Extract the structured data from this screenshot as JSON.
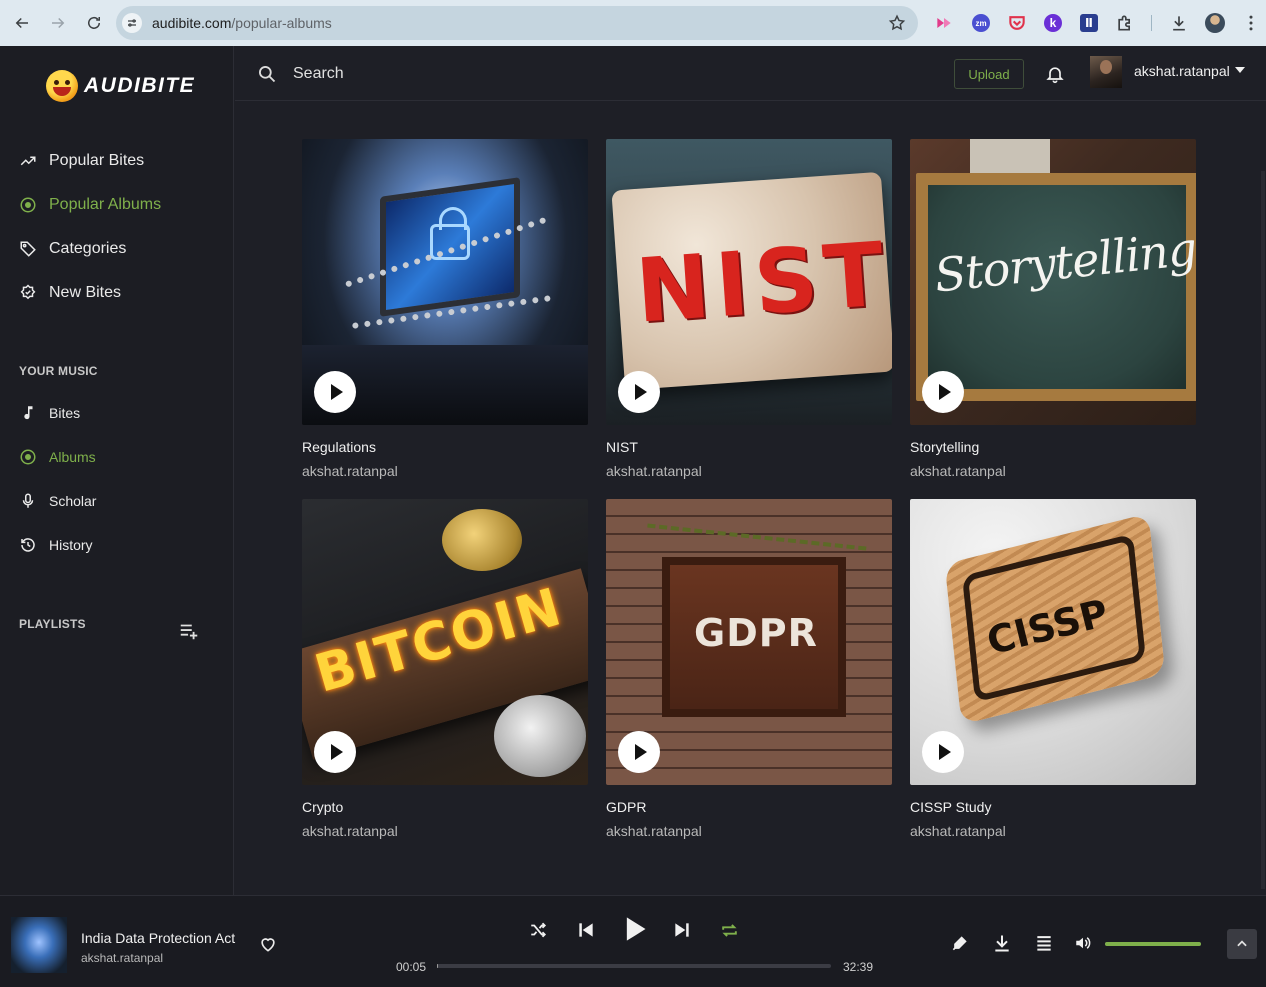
{
  "browser": {
    "url_host": "audibite.com",
    "url_path": "/popular-albums"
  },
  "app": {
    "logo_text": "AUDIBITE"
  },
  "sidebar": {
    "main_nav": [
      {
        "label": "Popular Bites",
        "icon": "trending-up-icon"
      },
      {
        "label": "Popular Albums",
        "icon": "album-icon",
        "active": true
      },
      {
        "label": "Categories",
        "icon": "tag-icon"
      },
      {
        "label": "New Bites",
        "icon": "new-badge-icon"
      }
    ],
    "your_music_label": "YOUR MUSIC",
    "your_music": [
      {
        "label": "Bites",
        "icon": "music-note-icon"
      },
      {
        "label": "Albums",
        "icon": "album-icon",
        "active": true
      },
      {
        "label": "Scholar",
        "icon": "microphone-icon"
      },
      {
        "label": "History",
        "icon": "history-icon"
      }
    ],
    "playlists_label": "PLAYLISTS"
  },
  "header": {
    "search_placeholder": "Search",
    "upload_label": "Upload",
    "username": "akshat.ratanpal"
  },
  "albums": [
    {
      "title": "Regulations",
      "artist": "akshat.ratanpal"
    },
    {
      "title": "NIST",
      "artist": "akshat.ratanpal",
      "cover_text": "NIST"
    },
    {
      "title": "Storytelling",
      "artist": "akshat.ratanpal",
      "cover_text": "Storytelling"
    },
    {
      "title": "Crypto",
      "artist": "akshat.ratanpal",
      "cover_text": "BITCOIN"
    },
    {
      "title": "GDPR",
      "artist": "akshat.ratanpal",
      "cover_text": "GDPR"
    },
    {
      "title": "CISSP Study",
      "artist": "akshat.ratanpal",
      "cover_text": "CISSP"
    }
  ],
  "player": {
    "track_title": "India Data Protection Act",
    "track_artist": "akshat.ratanpal",
    "elapsed": "00:05",
    "duration": "32:39",
    "progress_fraction": 0.003,
    "volume_fraction": 1.0,
    "accent_color": "#7fb04b"
  }
}
